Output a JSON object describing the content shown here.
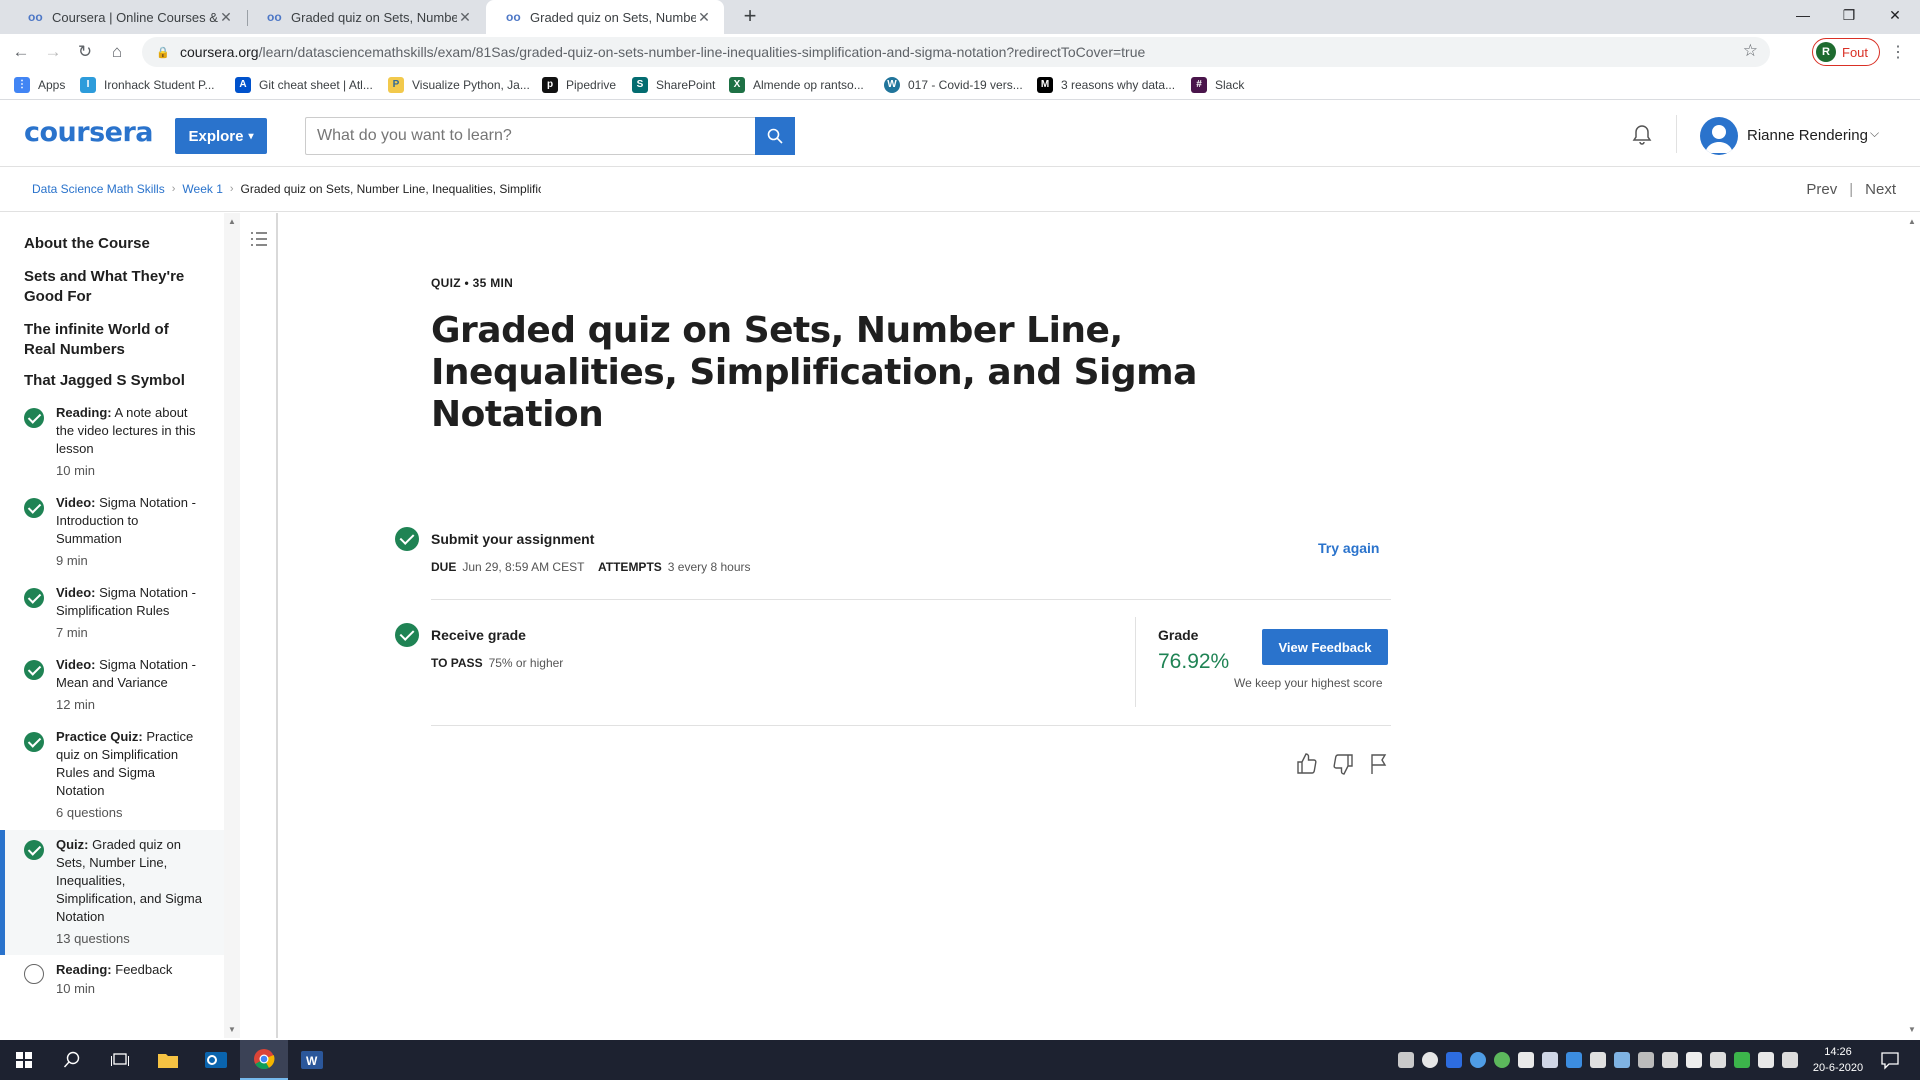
{
  "browser": {
    "tabs": [
      {
        "title": "Coursera | Online Courses & Credentials From Top Educators",
        "icon": "coursera-favicon"
      },
      {
        "title": "Graded quiz on Sets, Number Line, Inequalities",
        "icon": "coursera-favicon"
      },
      {
        "title": "Graded quiz on Sets, Number Line, Inequalities",
        "icon": "coursera-favicon",
        "active": true
      }
    ],
    "url_host": "coursera.org",
    "url_path": "/learn/datasciencemathskills/exam/81Sas/graded-quiz-on-sets-number-line-inequalities-simplification-and-sigma-notation?redirectToCover=true",
    "profile_initial": "R",
    "profile_label": "Fout",
    "bookmarks": [
      {
        "label": "Apps",
        "color": "#4285f4"
      },
      {
        "label": "Ironhack Student P...",
        "color": "#2d9cdb"
      },
      {
        "label": "Git cheat sheet | Atl...",
        "color": "#0052cc"
      },
      {
        "label": "Visualize Python, Ja...",
        "color": "#f2c94c"
      },
      {
        "label": "Pipedrive",
        "color": "#111111"
      },
      {
        "label": "SharePoint",
        "color": "#036c70"
      },
      {
        "label": "Almende op rantso...",
        "color": "#1e7145"
      },
      {
        "label": "017 - Covid-19 vers...",
        "color": "#21759b"
      },
      {
        "label": "3 reasons why data...",
        "color": "#000000"
      },
      {
        "label": "Slack",
        "color": "#4a154b"
      }
    ]
  },
  "header": {
    "logo": "coursera",
    "explore_label": "Explore",
    "search_placeholder": "What do you want to learn?",
    "user_name": "Rianne Rendering"
  },
  "breadcrumb": {
    "items": [
      "Data Science Math Skills",
      "Week 1"
    ],
    "current": "Graded quiz on Sets, Number Line, Inequalities, Simplification, and Sigma Notation",
    "prev": "Prev",
    "next": "Next"
  },
  "sidebar": {
    "sections": [
      "About the Course",
      "Sets and What They're Good For",
      "The infinite World of Real Numbers",
      "That Jagged S Symbol"
    ],
    "items": [
      {
        "type": "Reading:",
        "title": "A note about the video lectures in this lesson",
        "meta": "10 min",
        "done": true
      },
      {
        "type": "Video:",
        "title": "Sigma Notation - Introduction to Summation",
        "meta": "9 min",
        "done": true
      },
      {
        "type": "Video:",
        "title": "Sigma Notation - Simplification Rules",
        "meta": "7 min",
        "done": true
      },
      {
        "type": "Video:",
        "title": "Sigma Notation - Mean and Variance",
        "meta": "12 min",
        "done": true
      },
      {
        "type": "Practice Quiz:",
        "title": "Practice quiz on Simplification Rules and Sigma Notation",
        "meta": "6 questions",
        "done": true
      },
      {
        "type": "Quiz:",
        "title": "Graded quiz on Sets, Number Line, Inequalities, Simplification, and Sigma Notation",
        "meta": "13 questions",
        "done": true,
        "active": true
      },
      {
        "type": "Reading:",
        "title": "Feedback",
        "meta": "10 min",
        "done": false
      }
    ]
  },
  "main": {
    "quiz_label": "QUIZ • 35 MIN",
    "title": "Graded quiz on Sets, Number Line, Inequalities, Simplification, and Sigma Notation",
    "submit": {
      "title": "Submit your assignment",
      "due_key": "DUE",
      "due_value": "Jun 29, 8:59 AM CEST",
      "attempts_key": "ATTEMPTS",
      "attempts_value": "3 every 8 hours",
      "try_again": "Try again"
    },
    "receive": {
      "title": "Receive grade",
      "pass_key": "TO PASS",
      "pass_value": "75% or higher",
      "grade_label": "Grade",
      "grade_value": "76.92%",
      "view_feedback": "View Feedback",
      "keep_score": "We keep your highest score"
    },
    "colors": {
      "accent": "#2a73cc",
      "success": "#1f8354"
    }
  },
  "taskbar": {
    "time": "14:26",
    "date": "20-6-2020"
  }
}
